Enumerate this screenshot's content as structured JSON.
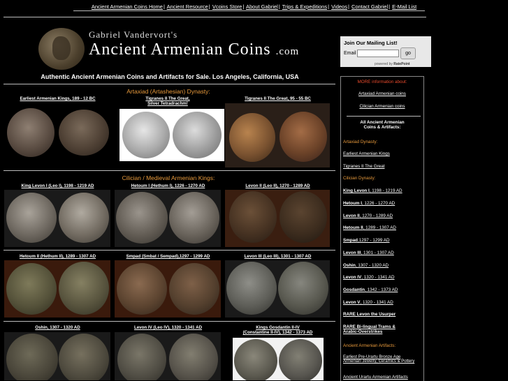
{
  "nav": {
    "items": [
      "Ancient Armenian Coins Home",
      "Ancient Resource",
      "Vcoins Store",
      "About Gabriel",
      "Trips & Expeditions",
      "Videos",
      "Contact Gabriel",
      "E-Mail List"
    ]
  },
  "header": {
    "byline": "Gabriel Vandervort's",
    "site_name": "Ancient Armenian Coins",
    "site_domain": ".com",
    "tagline": "Authentic Ancient Armenian Coins and Artifacts for Sale. Los Angeles, California, USA"
  },
  "mailing": {
    "title": "Join Our Mailing List!",
    "email_label": "Email",
    "go_label": "go",
    "powered_by": "powered by",
    "brand": "RatePoint"
  },
  "sections": {
    "artaxiad": "Artaxiad (Artashesian) Dynasty:",
    "cilician": "Cilician / Medieval Armenian Kings:"
  },
  "captions": {
    "c1": "Earliest Armenian Kings, 189 - 12 BC",
    "c2a": "Tigranes II The Great,",
    "c2b": "Silver Tetradrachm!",
    "c3": "Tigranes II The Great, 95 - 55 BC",
    "c4": "King Levon I (Leo I), 1198 - 1219 AD",
    "c5": "Hetoum I (Hethum I), 1226 - 1270 AD",
    "c6": "Levon II (Leo II), 1270 - 1289 AD",
    "c7": "Hetoum II (Hethum II), 1289 - 1307 AD",
    "c8": "Smpad (Smbat / Sempad),1297 - 1299 AD",
    "c9": "Levon III (Leo III), 1301 - 1307 AD",
    "c10": "Oshin, 1307 - 1320 AD",
    "c11": "Levon IV (Leo IV), 1320 - 1341 AD",
    "c12a": "Kings Gosdantin II-IV",
    "c12b": "(Constantine II-IV), 1342 - 1373 AD"
  },
  "sidebar": {
    "more": "MORE information about:",
    "links_top": [
      "Artaxiad Armenian coins",
      "Cilician Armenian coins"
    ],
    "all_title_1": "All Ancient Armenian",
    "all_title_2": "Coins & Artifacts:",
    "artaxiad_head": "Artaxiad Dynasty:",
    "artaxiad_links": [
      "Earliest Armenian Kings",
      "Tigranes II The Great"
    ],
    "cilician_head": "Cilician Dynasty:",
    "kings": [
      {
        "name": "King Levon I",
        "dates": ", 1198 - 1219 AD"
      },
      {
        "name": "Hetoum I",
        "dates": ", 1226 - 1270 AD"
      },
      {
        "name": "Levon II",
        "dates": ", 1270 - 1289 AD"
      },
      {
        "name": "Hetoum II",
        "dates": ", 1289 - 1307 AD"
      },
      {
        "name": "Smpad",
        "dates": ",1297 - 1299 AD"
      },
      {
        "name": "Levon III",
        "dates": ", 1301 - 1307 AD"
      },
      {
        "name": "Oshin",
        "dates": ", 1307 - 1320 AD"
      },
      {
        "name": "Levon IV",
        "dates": ", 1320 - 1341 AD"
      },
      {
        "name": "Gosdantin",
        "dates": ", 1342 - 1373 AD"
      },
      {
        "name": "Levon V",
        "dates": ", 1320 - 1341 AD"
      }
    ],
    "rare1": "RARE Levon the Usurper",
    "rare2a": "RARE Bi-lingual Trams &",
    "rare2b": "Arabic-Overstrikes",
    "artifacts_head": "Ancient Armenian Artifacts:",
    "art1a": "Earliest Pre-Urartu Bronze Age",
    "art1b": "Armenian Jewelry, Ceramics & Pottery",
    "art2": "Ancient Urartu Armenian Artifacts"
  },
  "colors": {
    "background": "#000000",
    "section_orange": "#e89a3c",
    "sidebar_red": "#e84a2c"
  }
}
